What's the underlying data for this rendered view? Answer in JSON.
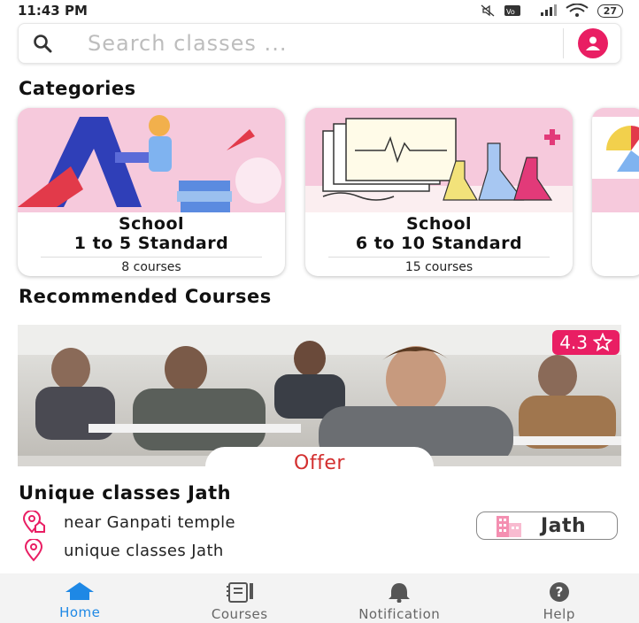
{
  "status_bar": {
    "time": "11:43 PM",
    "battery": "27"
  },
  "search": {
    "placeholder": "Search classes ..."
  },
  "categories": {
    "title": "Categories",
    "items": [
      {
        "name": "School\n1 to 5 Standard",
        "count": "8 courses"
      },
      {
        "name": "School\n6 to 10 Standard",
        "count": "15 courses"
      }
    ]
  },
  "recommended": {
    "title": "Recommended Courses",
    "course": {
      "rating": "4.3",
      "offer_label": "Offer",
      "title": "Unique classes Jath",
      "address": "near Ganpati temple",
      "institute": "unique classes Jath",
      "city": "Jath"
    }
  },
  "nav": {
    "items": [
      {
        "label": "Home",
        "icon": "home-icon"
      },
      {
        "label": "Courses",
        "icon": "notebook-icon"
      },
      {
        "label": "Notification",
        "icon": "bell-icon"
      },
      {
        "label": "Help",
        "icon": "help-icon"
      }
    ],
    "active": "Home"
  },
  "colors": {
    "accent": "#e91e63",
    "nav_active": "#1e88e5",
    "offer": "#d32f2f"
  }
}
